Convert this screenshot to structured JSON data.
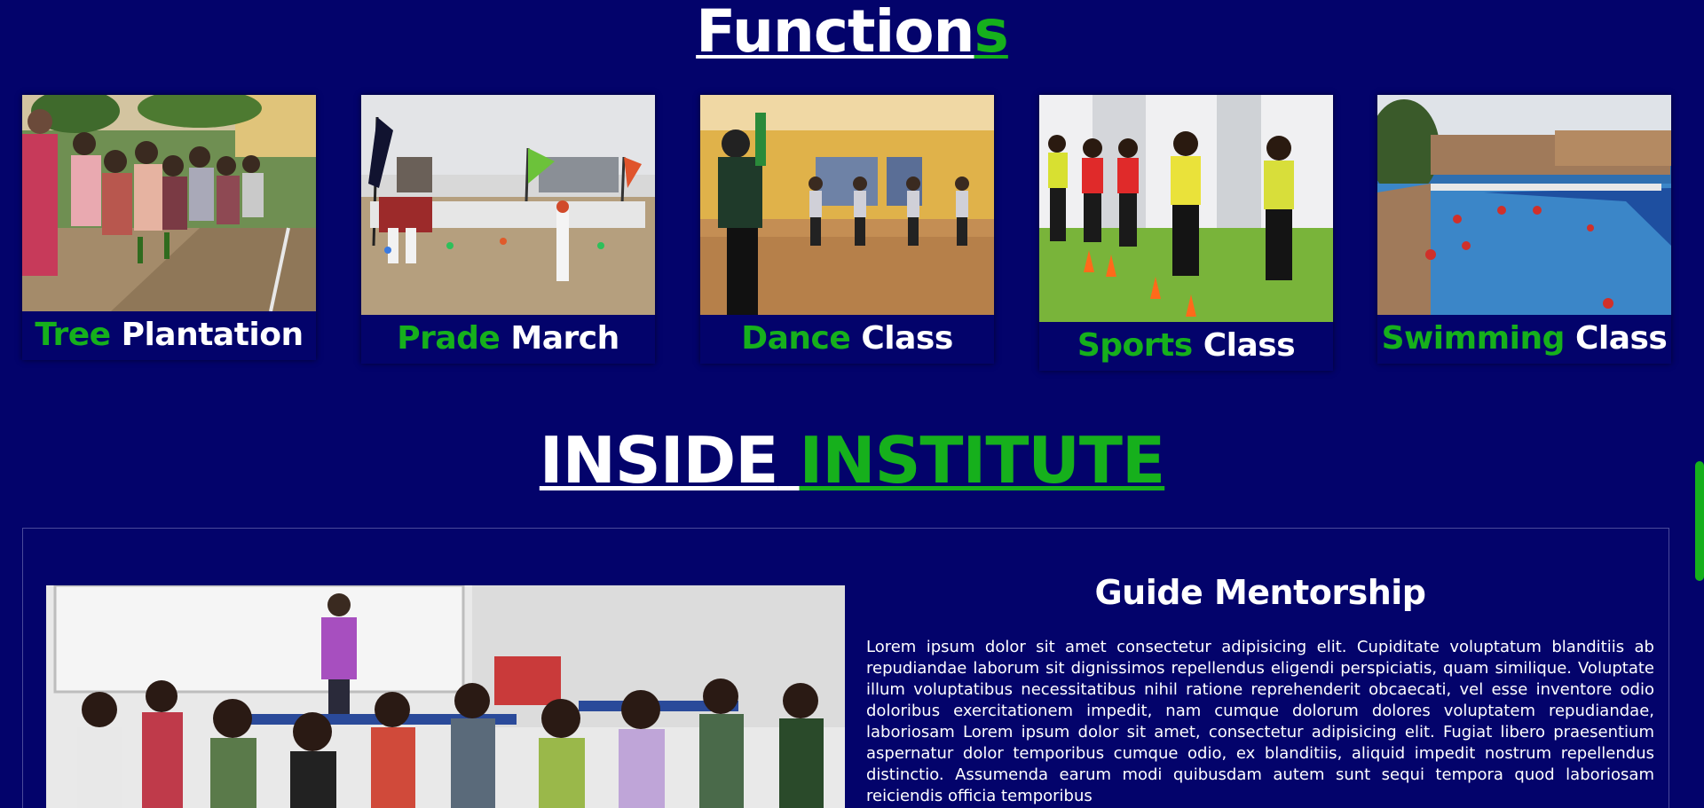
{
  "functions": {
    "title_main": "Function",
    "title_accent": "s",
    "cards": [
      {
        "label_green": "Tree",
        "label_white": "Plantation"
      },
      {
        "label_green": "Prade",
        "label_white": "March"
      },
      {
        "label_green": "Dance",
        "label_white": "Class"
      },
      {
        "label_green": "Sports",
        "label_white": "Class"
      },
      {
        "label_green": "Swimming",
        "label_white": "Class"
      }
    ]
  },
  "inside": {
    "title_white": "INSIDE",
    "title_green": "INSTITUTE",
    "card_title": "Guide Mentorship",
    "paragraph": "Lorem ipsum dolor sit amet consectetur adipisicing elit. Cupiditate voluptatum blanditiis ab repudiandae laborum sit dignissimos repellendus eligendi perspiciatis, quam similique. Voluptate illum voluptatibus necessitatibus nihil ratione reprehenderit obcaecati, vel esse inventore odio doloribus exercitationem impedit, nam cumque dolorum dolores voluptatem repudiandae, laboriosam Lorem ipsum dolor sit amet, consectetur adipisicing elit. Fugiat libero praesentium aspernatur dolor temporibus cumque odio, ex blanditiis, aliquid impedit nostrum repellendus distinctio. Assumenda earum modi quibusdam autem sunt sequi tempora quod laboriosam reiciendis officia temporibus"
  },
  "colors": {
    "background": "#03036b",
    "accent_green": "#16b01c",
    "text_white": "#ffffff"
  }
}
